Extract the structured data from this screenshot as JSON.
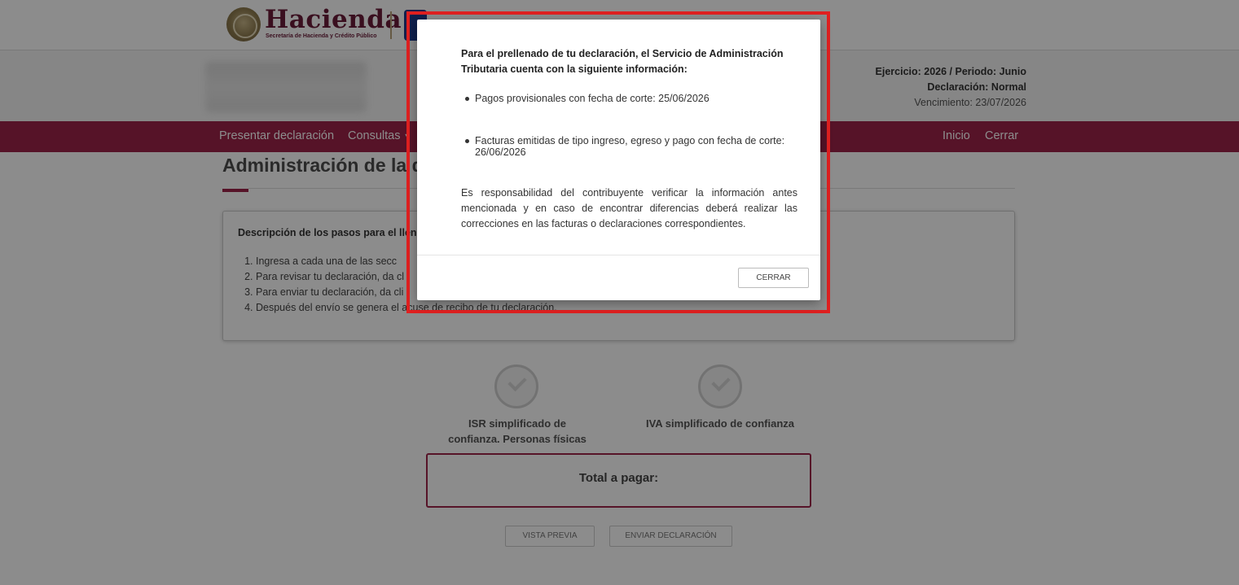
{
  "header": {
    "brand": "Hacienda",
    "brand_sub": "Secretaría de Hacienda y Crédito Público"
  },
  "info": {
    "period": "Ejercicio: 2026 / Periodo: Junio",
    "declaration": "Declaración: Normal",
    "due": "Vencimiento: 23/07/2026"
  },
  "nav": {
    "present": "Presentar declaración",
    "queries": "Consultas",
    "home": "Inicio",
    "close": "Cerrar"
  },
  "main": {
    "title": "Administración de la d",
    "steps_title": "Descripción de los pasos para el llen",
    "steps": [
      "Ingresa a cada una de las secc",
      "Para revisar tu declaración, da cl",
      "Para enviar tu declaración, da cli",
      "Después del envío se genera el acuse de recibo de tu declaración."
    ],
    "sections": [
      "ISR simplificado de confianza. Personas físicas",
      "IVA simplificado de confianza"
    ],
    "total_label": "Total a pagar:",
    "preview_button": "VISTA PREVIA",
    "send_button": "ENVIAR DECLARACIÓN"
  },
  "modal": {
    "intro": "Para el prellenado de tu declaración, el Servicio de Administración Tributaria cuenta con la siguiente información:",
    "bullets": [
      "Pagos provisionales con fecha de corte: 25/06/2026",
      "Facturas emitidas de tipo ingreso, egreso y pago con fecha de corte: 26/06/2026"
    ],
    "paragraph": "Es responsabilidad del contribuyente verificar la información antes mencionada y en caso de encontrar diferencias deberá realizar las correcciones en las facturas o declaraciones correspondientes.",
    "close_button": "CERRAR"
  },
  "colors": {
    "brand": "#9d2449",
    "highlight": "#e02020"
  }
}
